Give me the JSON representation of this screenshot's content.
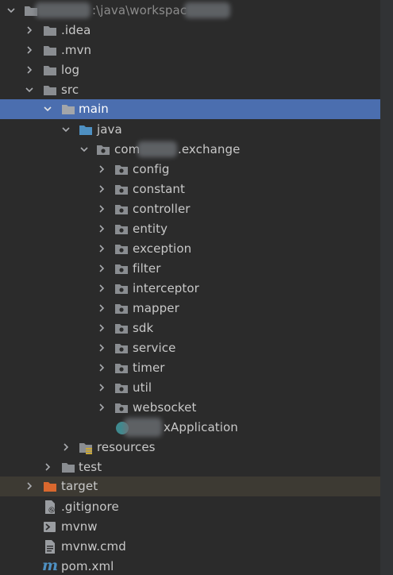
{
  "tree": {
    "root": {
      "label": ":\\java\\workspac"
    },
    "nodes": {
      "idea": ".idea",
      "mvn": ".mvn",
      "log": "log",
      "src": "src",
      "main": "main",
      "java": "java",
      "pkg_prefix": "com",
      "pkg_suffix": ".exchange",
      "config": "config",
      "constant": "constant",
      "controller": "controller",
      "entity": "entity",
      "exception": "exception",
      "filter": "filter",
      "interceptor": "interceptor",
      "mapper": "mapper",
      "sdk": "sdk",
      "service": "service",
      "timer": "timer",
      "util": "util",
      "websocket": "websocket",
      "app_suffix": "xApplication",
      "resources": "resources",
      "test": "test",
      "target": "target",
      "gitignore": ".gitignore",
      "mvnw": "mvnw",
      "mvnw_cmd": "mvnw.cmd",
      "pom": "pom.xml"
    }
  },
  "colors": {
    "background": "#2b2b2b",
    "selection": "#4b6eaf",
    "excluded": "#3d3a33",
    "folder": "#8a8d91",
    "source_folder": "#4e90c2",
    "target_folder": "#d9682e",
    "maven": "#4e90c2"
  }
}
